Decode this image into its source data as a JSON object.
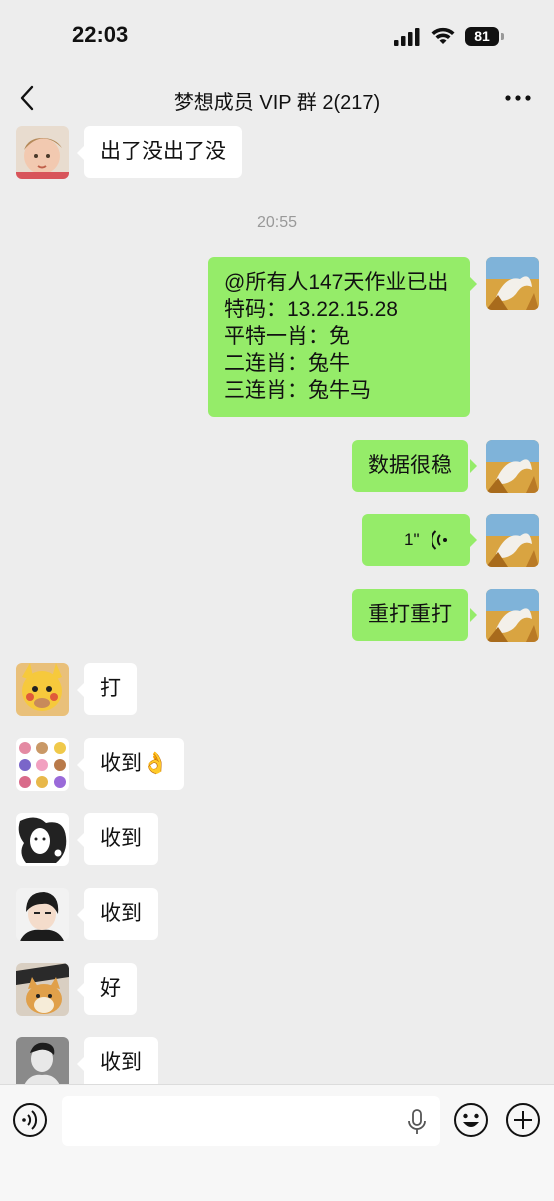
{
  "status_bar": {
    "time": "22:03",
    "battery": "81"
  },
  "nav": {
    "title": "梦想成员 VIP 群 2(217)"
  },
  "messages": [
    {
      "side": "left",
      "text": "出了没出了没"
    },
    {
      "type": "time",
      "text": "20:55"
    },
    {
      "side": "right",
      "lines": [
        "@所有人147天作业已出",
        "特码：13.22.15.28",
        "平特一肖：免",
        "二连肖：兔牛",
        "三连肖：兔牛马"
      ]
    },
    {
      "side": "right",
      "text": "数据很稳"
    },
    {
      "side": "right",
      "type": "voice",
      "duration": "1\""
    },
    {
      "side": "right",
      "text": "重打重打"
    },
    {
      "side": "left",
      "text": "打"
    },
    {
      "side": "left",
      "text": "收到👌"
    },
    {
      "side": "left",
      "text": "收到"
    },
    {
      "side": "left",
      "text": "收到"
    },
    {
      "side": "left",
      "text": "好"
    },
    {
      "side": "left",
      "text": "收到"
    }
  ],
  "colors": {
    "my_bubble": "#95ec69",
    "their_bubble": "#ffffff",
    "background": "#ededed"
  },
  "icons": [
    "back-chevron-icon",
    "more-icon",
    "voice-wave-icon",
    "microphone-icon",
    "emoji-icon",
    "plus-icon"
  ]
}
